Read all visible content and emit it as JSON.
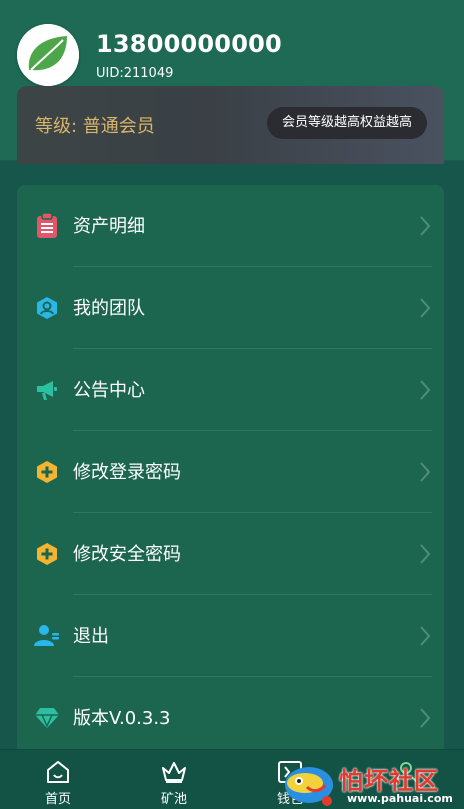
{
  "user": {
    "phone": "13800000000",
    "uid": "UID:211049"
  },
  "level": {
    "text": "等级: 普通会员",
    "badge": "会员等级越高权益越高"
  },
  "menu": [
    {
      "label": "资产明细",
      "icon": "clipboard-icon",
      "color": "#e2566a"
    },
    {
      "label": "我的团队",
      "icon": "team-icon",
      "color": "#29b6e8"
    },
    {
      "label": "公告中心",
      "icon": "megaphone-icon",
      "color": "#2cc0a0"
    },
    {
      "label": "修改登录密码",
      "icon": "hexagon-plus-icon",
      "color": "#f2b431"
    },
    {
      "label": "修改安全密码",
      "icon": "hexagon-plus-icon",
      "color": "#f2b431"
    },
    {
      "label": "退出",
      "icon": "user-exit-icon",
      "color": "#29b6e8"
    },
    {
      "label": "版本V.0.3.3",
      "icon": "diamond-icon",
      "color": "#2cc0a0"
    }
  ],
  "nav": [
    {
      "label": "首页",
      "icon": "home-icon"
    },
    {
      "label": "矿池",
      "icon": "crown-icon"
    },
    {
      "label": "钱包",
      "icon": "wallet-icon"
    },
    {
      "label": "",
      "icon": "user-icon"
    }
  ],
  "watermark": {
    "text": "怕坏社区",
    "url": "www.pahuai.com"
  }
}
